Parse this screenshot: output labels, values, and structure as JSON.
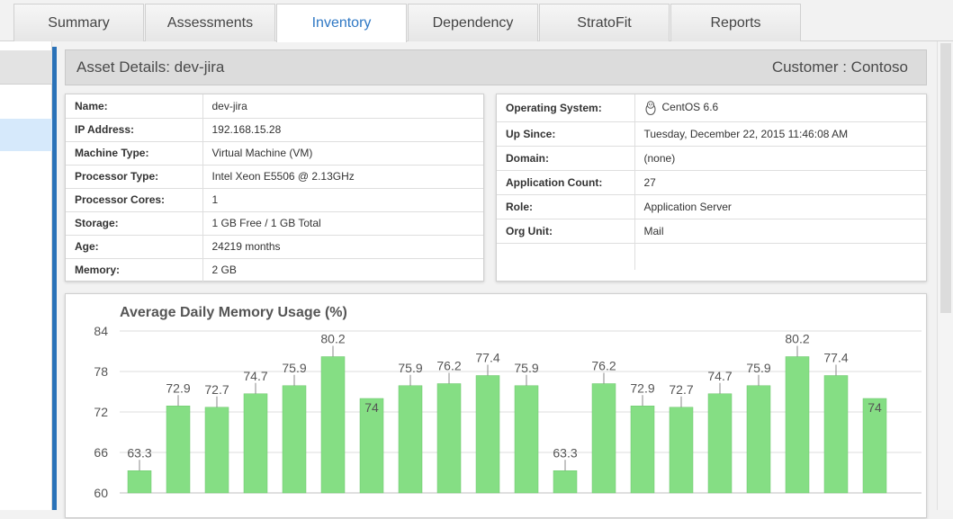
{
  "tabs": [
    {
      "label": "Summary",
      "active": false
    },
    {
      "label": "Assessments",
      "active": false
    },
    {
      "label": "Inventory",
      "active": true
    },
    {
      "label": "Dependency",
      "active": false
    },
    {
      "label": "StratoFit",
      "active": false
    },
    {
      "label": "Reports",
      "active": false
    }
  ],
  "header": {
    "title": "Asset Details: dev-jira",
    "customer": "Customer : Contoso"
  },
  "details_left": [
    {
      "key": "Name:",
      "value": "dev-jira"
    },
    {
      "key": "IP Address:",
      "value": "192.168.15.28"
    },
    {
      "key": "Machine Type:",
      "value": "Virtual Machine (VM)"
    },
    {
      "key": "Processor Type:",
      "value": "Intel Xeon E5506 @ 2.13GHz"
    },
    {
      "key": "Processor Cores:",
      "value": "1"
    },
    {
      "key": "Storage:",
      "value": "1 GB Free / 1 GB Total"
    },
    {
      "key": "Age:",
      "value": "24219 months"
    },
    {
      "key": "Memory:",
      "value": "2 GB"
    }
  ],
  "details_right": [
    {
      "key": "Operating System:",
      "value": "CentOS 6.6",
      "icon": "linux-penguin-icon"
    },
    {
      "key": "Up Since:",
      "value": "Tuesday, December 22, 2015 11:46:08 AM"
    },
    {
      "key": "Domain:",
      "value": "(none)"
    },
    {
      "key": "Application Count:",
      "value": "27"
    },
    {
      "key": "Role:",
      "value": "Application Server"
    },
    {
      "key": "Org Unit:",
      "value": "Mail"
    },
    {
      "key": "",
      "value": ""
    }
  ],
  "chart_data": {
    "type": "bar",
    "title": "Average Daily Memory Usage (%)",
    "yticks": [
      "84",
      "78",
      "72",
      "66",
      "60"
    ],
    "ylim": [
      60,
      84
    ],
    "values": [
      63.3,
      72.9,
      72.7,
      74.7,
      75.9,
      80.2,
      74,
      75.9,
      76.2,
      77.4,
      75.9,
      63.3,
      76.2,
      72.9,
      72.7,
      74.7,
      75.9,
      80.2,
      77.4,
      74
    ],
    "value_labels": [
      "63.3",
      "72.9",
      "72.7",
      "74.7",
      "75.9",
      "80.2",
      "74",
      "75.9",
      "76.2",
      "77.4",
      "75.9",
      "63.3",
      "76.2",
      "72.9",
      "72.7",
      "74.7",
      "75.9",
      "80.2",
      "77.4",
      "74"
    ],
    "bar_color": "#85de84",
    "bar_border": "#6cc66b",
    "grid": true
  }
}
